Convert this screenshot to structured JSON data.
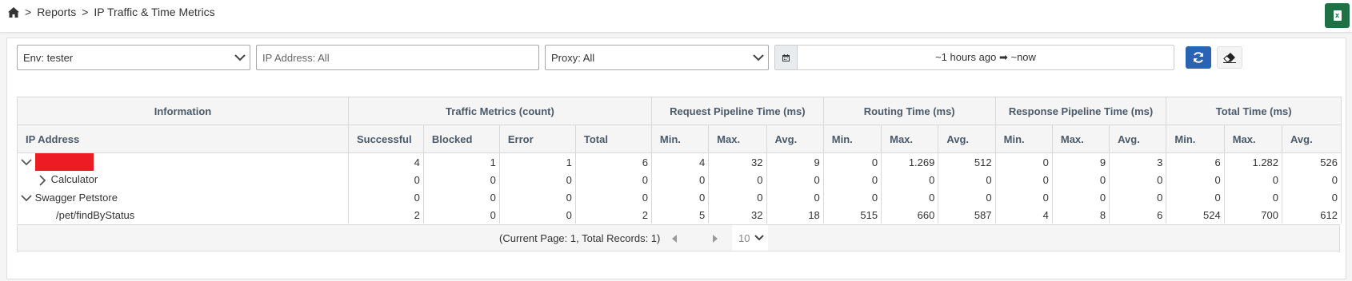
{
  "breadcrumb": {
    "home_icon": "home-icon",
    "separator": ">",
    "items": [
      "Reports",
      "IP Traffic & Time Metrics"
    ]
  },
  "toolbar": {
    "export_icon": "excel-icon",
    "refresh_icon": "refresh-icon",
    "clear_icon": "eraser-icon"
  },
  "filters": {
    "env": "Env: tester",
    "ip_placeholder": "IP Address: All",
    "proxy": "Proxy: All",
    "calendar_icon": "calendar-icon",
    "range_from": "~1 hours ago",
    "range_arrow": "➡",
    "range_to": "~now"
  },
  "table": {
    "groups": [
      "Information",
      "Traffic Metrics (count)",
      "Request Pipeline Time (ms)",
      "Routing Time (ms)",
      "Response Pipeline Time (ms)",
      "Total Time (ms)"
    ],
    "columns": [
      "IP Address",
      "Successful",
      "Blocked",
      "Error",
      "Total",
      "Min.",
      "Max.",
      "Avg.",
      "Min.",
      "Max.",
      "Avg.",
      "Min.",
      "Max.",
      "Avg.",
      "Min.",
      "Max.",
      "Avg."
    ],
    "rows": [
      {
        "label": "",
        "redacted": true,
        "toggle": "expanded",
        "values": [
          "4",
          "1",
          "1",
          "6",
          "4",
          "32",
          "9",
          "0",
          "1.269",
          "512",
          "0",
          "9",
          "3",
          "6",
          "1.282",
          "526"
        ]
      },
      {
        "label": "Calculator",
        "redacted": false,
        "toggle": "collapsed",
        "values": [
          "0",
          "0",
          "0",
          "0",
          "0",
          "0",
          "0",
          "0",
          "0",
          "0",
          "0",
          "0",
          "0",
          "0",
          "0",
          "0"
        ]
      },
      {
        "label": "Swagger Petstore",
        "redacted": false,
        "toggle": "expanded",
        "values": [
          "0",
          "0",
          "0",
          "0",
          "0",
          "0",
          "0",
          "0",
          "0",
          "0",
          "0",
          "0",
          "0",
          "0",
          "0",
          "0"
        ]
      },
      {
        "label": "/pet/findByStatus",
        "redacted": false,
        "toggle": "none",
        "values": [
          "2",
          "0",
          "0",
          "2",
          "5",
          "32",
          "18",
          "515",
          "660",
          "587",
          "4",
          "8",
          "6",
          "524",
          "700",
          "612"
        ]
      }
    ]
  },
  "pagination": {
    "summary": "(Current Page: 1, Total Records: 1)",
    "page_size": "10"
  },
  "colors": {
    "accent": "#2a62b4",
    "excel": "#1e7145",
    "redaction": "#ed1c24"
  }
}
